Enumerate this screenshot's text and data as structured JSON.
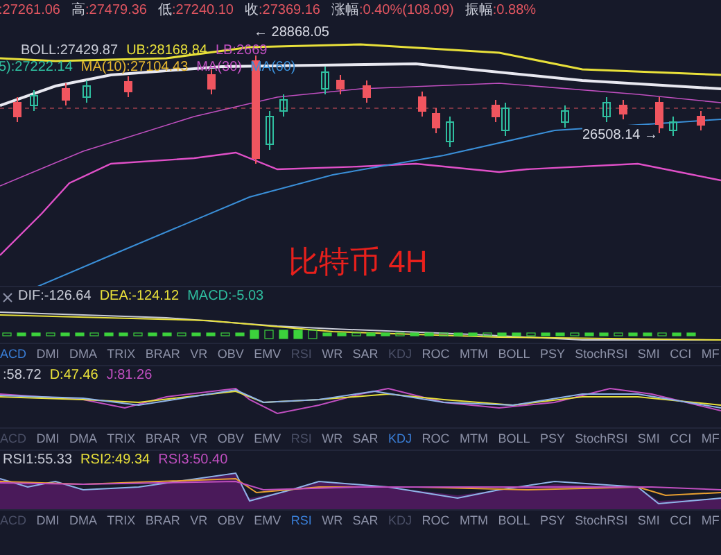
{
  "quote": [
    {
      "value": ":27261.06"
    },
    {
      "label": "高",
      "value": ":27479.36"
    },
    {
      "label": "低",
      "value": ":27240.10"
    },
    {
      "label": "收",
      "value": ":27369.16"
    },
    {
      "label": "涨幅",
      "value": ":0.40%(108.09)"
    },
    {
      "label": "振幅",
      "value": ":0.88%"
    }
  ],
  "main_chart": {
    "high_marker": "← 28868.05",
    "low_marker": "26508.14 →",
    "title": "比特币 4H",
    "boll_legend": [
      {
        "text": "BOLL:27429.87",
        "color": "#c8cbd6"
      },
      {
        "text": "UB:28168.84",
        "color": "#e8e03a"
      },
      {
        "text": "LB:2669",
        "color": "#c04fc0"
      }
    ],
    "ma_legend": [
      {
        "text": "5):27222.14",
        "color": "#2fbfa0"
      },
      {
        "text": "MA(10):27104.43",
        "color": "#e8b830"
      },
      {
        "text": "MA(30)",
        "color": "#c04fc0"
      },
      {
        "text": "MA(60)",
        "color": "#3a8fd8"
      }
    ]
  },
  "panels": [
    {
      "kind": "macd",
      "closable": true,
      "legend": [
        {
          "text": "DIF:-126.64",
          "color": "#c8cbd6"
        },
        {
          "text": "DEA:-124.12",
          "color": "#e8e03a"
        },
        {
          "text": "MACD:-5.03",
          "color": "#2fbfa0"
        }
      ],
      "tabs": [
        {
          "label": "ACD",
          "selected": true,
          "disabled": false
        },
        {
          "label": "DMI",
          "selected": false,
          "disabled": false
        },
        {
          "label": "DMA",
          "selected": false,
          "disabled": false
        },
        {
          "label": "TRIX",
          "selected": false,
          "disabled": false
        },
        {
          "label": "BRAR",
          "selected": false,
          "disabled": false
        },
        {
          "label": "VR",
          "selected": false,
          "disabled": false
        },
        {
          "label": "OBV",
          "selected": false,
          "disabled": false
        },
        {
          "label": "EMV",
          "selected": false,
          "disabled": false
        },
        {
          "label": "RSI",
          "selected": false,
          "disabled": true
        },
        {
          "label": "WR",
          "selected": false,
          "disabled": false
        },
        {
          "label": "SAR",
          "selected": false,
          "disabled": false
        },
        {
          "label": "KDJ",
          "selected": false,
          "disabled": true
        },
        {
          "label": "ROC",
          "selected": false,
          "disabled": false
        },
        {
          "label": "MTM",
          "selected": false,
          "disabled": false
        },
        {
          "label": "BOLL",
          "selected": false,
          "disabled": false
        },
        {
          "label": "PSY",
          "selected": false,
          "disabled": false
        },
        {
          "label": "StochRSI",
          "selected": false,
          "disabled": false
        },
        {
          "label": "SMI",
          "selected": false,
          "disabled": false
        },
        {
          "label": "CCI",
          "selected": false,
          "disabled": false
        },
        {
          "label": "MF",
          "selected": false,
          "disabled": false
        }
      ]
    },
    {
      "kind": "kdj",
      "closable": false,
      "legend": [
        {
          "text": ":58.72",
          "color": "#c8cbd6"
        },
        {
          "text": "D:47.46",
          "color": "#e8e03a"
        },
        {
          "text": "J:81.26",
          "color": "#c04fc0"
        }
      ],
      "tabs": [
        {
          "label": "ACD",
          "selected": false,
          "disabled": true
        },
        {
          "label": "DMI",
          "selected": false,
          "disabled": false
        },
        {
          "label": "DMA",
          "selected": false,
          "disabled": false
        },
        {
          "label": "TRIX",
          "selected": false,
          "disabled": false
        },
        {
          "label": "BRAR",
          "selected": false,
          "disabled": false
        },
        {
          "label": "VR",
          "selected": false,
          "disabled": false
        },
        {
          "label": "OBV",
          "selected": false,
          "disabled": false
        },
        {
          "label": "EMV",
          "selected": false,
          "disabled": false
        },
        {
          "label": "RSI",
          "selected": false,
          "disabled": true
        },
        {
          "label": "WR",
          "selected": false,
          "disabled": false
        },
        {
          "label": "SAR",
          "selected": false,
          "disabled": false
        },
        {
          "label": "KDJ",
          "selected": true,
          "disabled": false
        },
        {
          "label": "ROC",
          "selected": false,
          "disabled": false
        },
        {
          "label": "MTM",
          "selected": false,
          "disabled": false
        },
        {
          "label": "BOLL",
          "selected": false,
          "disabled": false
        },
        {
          "label": "PSY",
          "selected": false,
          "disabled": false
        },
        {
          "label": "StochRSI",
          "selected": false,
          "disabled": false
        },
        {
          "label": "SMI",
          "selected": false,
          "disabled": false
        },
        {
          "label": "CCI",
          "selected": false,
          "disabled": false
        },
        {
          "label": "MF",
          "selected": false,
          "disabled": false
        }
      ]
    },
    {
      "kind": "rsi",
      "closable": false,
      "legend": [
        {
          "text": "RSI1:55.33",
          "color": "#c8cbd6"
        },
        {
          "text": "RSI2:49.34",
          "color": "#e8e03a"
        },
        {
          "text": "RSI3:50.40",
          "color": "#c04fc0"
        }
      ],
      "tabs": [
        {
          "label": "ACD",
          "selected": false,
          "disabled": true
        },
        {
          "label": "DMI",
          "selected": false,
          "disabled": false
        },
        {
          "label": "DMA",
          "selected": false,
          "disabled": false
        },
        {
          "label": "TRIX",
          "selected": false,
          "disabled": false
        },
        {
          "label": "BRAR",
          "selected": false,
          "disabled": false
        },
        {
          "label": "VR",
          "selected": false,
          "disabled": false
        },
        {
          "label": "OBV",
          "selected": false,
          "disabled": false
        },
        {
          "label": "EMV",
          "selected": false,
          "disabled": false
        },
        {
          "label": "RSI",
          "selected": true,
          "disabled": false
        },
        {
          "label": "WR",
          "selected": false,
          "disabled": false
        },
        {
          "label": "SAR",
          "selected": false,
          "disabled": false
        },
        {
          "label": "KDJ",
          "selected": false,
          "disabled": true
        },
        {
          "label": "ROC",
          "selected": false,
          "disabled": false
        },
        {
          "label": "MTM",
          "selected": false,
          "disabled": false
        },
        {
          "label": "BOLL",
          "selected": false,
          "disabled": false
        },
        {
          "label": "PSY",
          "selected": false,
          "disabled": false
        },
        {
          "label": "StochRSI",
          "selected": false,
          "disabled": false
        },
        {
          "label": "SMI",
          "selected": false,
          "disabled": false
        },
        {
          "label": "CCI",
          "selected": false,
          "disabled": false
        },
        {
          "label": "MF",
          "selected": false,
          "disabled": false
        }
      ]
    }
  ]
}
